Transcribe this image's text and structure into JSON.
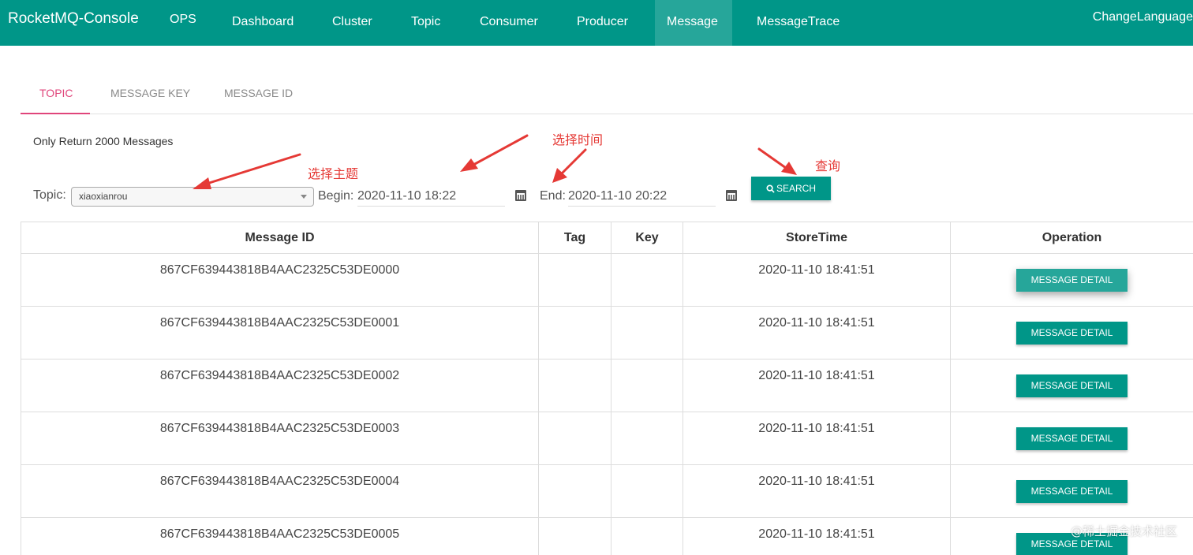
{
  "navbar": {
    "brand": "RocketMQ-Console",
    "items": [
      {
        "label": "OPS"
      },
      {
        "label": "Dashboard"
      },
      {
        "label": "Cluster"
      },
      {
        "label": "Topic"
      },
      {
        "label": "Consumer"
      },
      {
        "label": "Producer"
      },
      {
        "label": "Message",
        "active": true
      },
      {
        "label": "MessageTrace"
      }
    ],
    "change_language": "ChangeLanguage"
  },
  "tabs": [
    {
      "label": "TOPIC",
      "active": true
    },
    {
      "label": "MESSAGE KEY"
    },
    {
      "label": "MESSAGE ID"
    }
  ],
  "notice": "Only Return 2000 Messages",
  "form": {
    "topic_label": "Topic:",
    "topic_value": "xiaoxianrou",
    "begin_label": "Begin:",
    "begin_value": "2020-11-10 18:22",
    "end_label": "End:",
    "end_value": "2020-11-10 20:22",
    "search_label": "SEARCH"
  },
  "annotations": {
    "select_topic": "选择主题",
    "select_time": "选择时间",
    "query": "查询",
    "color": "#e53935"
  },
  "table": {
    "headers": [
      "Message ID",
      "Tag",
      "Key",
      "StoreTime",
      "Operation"
    ],
    "detail_label": "MESSAGE DETAIL",
    "rows": [
      {
        "id": "867CF639443818B4AAC2325C53DE0000",
        "tag": "",
        "key": "",
        "store_time": "2020-11-10 18:41:51"
      },
      {
        "id": "867CF639443818B4AAC2325C53DE0001",
        "tag": "",
        "key": "",
        "store_time": "2020-11-10 18:41:51"
      },
      {
        "id": "867CF639443818B4AAC2325C53DE0002",
        "tag": "",
        "key": "",
        "store_time": "2020-11-10 18:41:51"
      },
      {
        "id": "867CF639443818B4AAC2325C53DE0003",
        "tag": "",
        "key": "",
        "store_time": "2020-11-10 18:41:51"
      },
      {
        "id": "867CF639443818B4AAC2325C53DE0004",
        "tag": "",
        "key": "",
        "store_time": "2020-11-10 18:41:51"
      },
      {
        "id": "867CF639443818B4AAC2325C53DE0005",
        "tag": "",
        "key": "",
        "store_time": "2020-11-10 18:41:51"
      }
    ]
  },
  "watermark": "@稀土掘金技术社区",
  "colors": {
    "primary": "#009688",
    "active_tab": "#e0457b"
  },
  "icons": {
    "search": "search-icon",
    "calendar": "calendar-icon",
    "dropdown": "chevron-down-icon"
  }
}
